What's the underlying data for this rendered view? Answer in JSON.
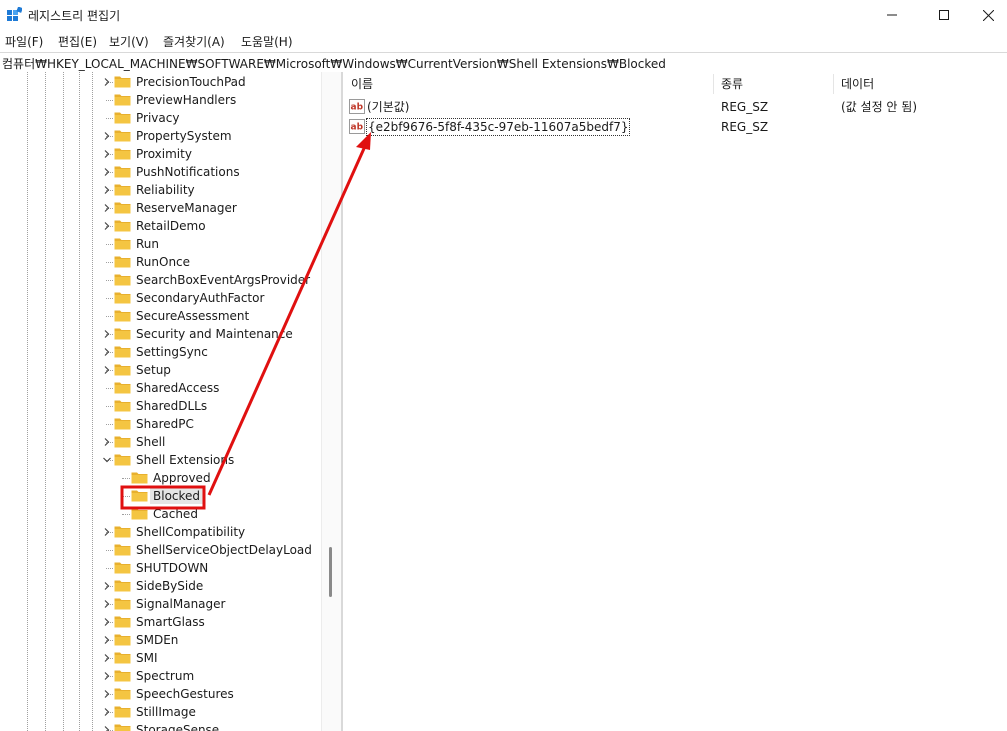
{
  "window": {
    "title": "레지스트리 편집기",
    "accent_color": "#1e7ad6"
  },
  "menu": {
    "items": [
      "파일(F)",
      "편집(E)",
      "보기(V)",
      "즐겨찾기(A)",
      "도움말(H)"
    ]
  },
  "address": {
    "path": "컴퓨터₩HKEY_LOCAL_MACHINE₩SOFTWARE₩Microsoft₩Windows₩CurrentVersion₩Shell Extensions₩Blocked"
  },
  "tree": {
    "items": [
      {
        "label": "PrecisionTouchPad",
        "expandable": true
      },
      {
        "label": "PreviewHandlers",
        "expandable": false
      },
      {
        "label": "Privacy",
        "expandable": false
      },
      {
        "label": "PropertySystem",
        "expandable": true
      },
      {
        "label": "Proximity",
        "expandable": true
      },
      {
        "label": "PushNotifications",
        "expandable": true
      },
      {
        "label": "Reliability",
        "expandable": true
      },
      {
        "label": "ReserveManager",
        "expandable": true
      },
      {
        "label": "RetailDemo",
        "expandable": true
      },
      {
        "label": "Run",
        "expandable": false
      },
      {
        "label": "RunOnce",
        "expandable": false
      },
      {
        "label": "SearchBoxEventArgsProvider",
        "expandable": false
      },
      {
        "label": "SecondaryAuthFactor",
        "expandable": false
      },
      {
        "label": "SecureAssessment",
        "expandable": false
      },
      {
        "label": "Security and Maintenance",
        "expandable": true
      },
      {
        "label": "SettingSync",
        "expandable": true
      },
      {
        "label": "Setup",
        "expandable": true
      },
      {
        "label": "SharedAccess",
        "expandable": false
      },
      {
        "label": "SharedDLLs",
        "expandable": false
      },
      {
        "label": "SharedPC",
        "expandable": false
      },
      {
        "label": "Shell",
        "expandable": true
      },
      {
        "label": "Shell Extensions",
        "expandable": true,
        "expanded": true
      },
      {
        "label": "Approved",
        "expandable": false,
        "child": true
      },
      {
        "label": "Blocked",
        "expandable": false,
        "child": true,
        "selected": true
      },
      {
        "label": "Cached",
        "expandable": false,
        "child": true
      },
      {
        "label": "ShellCompatibility",
        "expandable": true
      },
      {
        "label": "ShellServiceObjectDelayLoad",
        "expandable": false
      },
      {
        "label": "SHUTDOWN",
        "expandable": false
      },
      {
        "label": "SideBySide",
        "expandable": true
      },
      {
        "label": "SignalManager",
        "expandable": true
      },
      {
        "label": "SmartGlass",
        "expandable": true
      },
      {
        "label": "SMDEn",
        "expandable": true
      },
      {
        "label": "SMI",
        "expandable": true
      },
      {
        "label": "Spectrum",
        "expandable": true
      },
      {
        "label": "SpeechGestures",
        "expandable": true
      },
      {
        "label": "StillImage",
        "expandable": true
      },
      {
        "label": "StorageSense",
        "expandable": true
      }
    ]
  },
  "columns": {
    "name": "이름",
    "type": "종류",
    "data": "데이터"
  },
  "values": [
    {
      "name": "(기본값)",
      "type": "REG_SZ",
      "data": "(값 설정 안 됨)",
      "icon": "string-value-icon"
    },
    {
      "name": "{e2bf9676-5f8f-435c-97eb-11607a5bedf7}",
      "type": "REG_SZ",
      "data": "",
      "icon": "string-value-icon",
      "selected": true
    }
  ],
  "annotation": {
    "highlight_color": "#e01010",
    "arrow_color": "#e01010"
  },
  "folder_color": "#f4c542"
}
